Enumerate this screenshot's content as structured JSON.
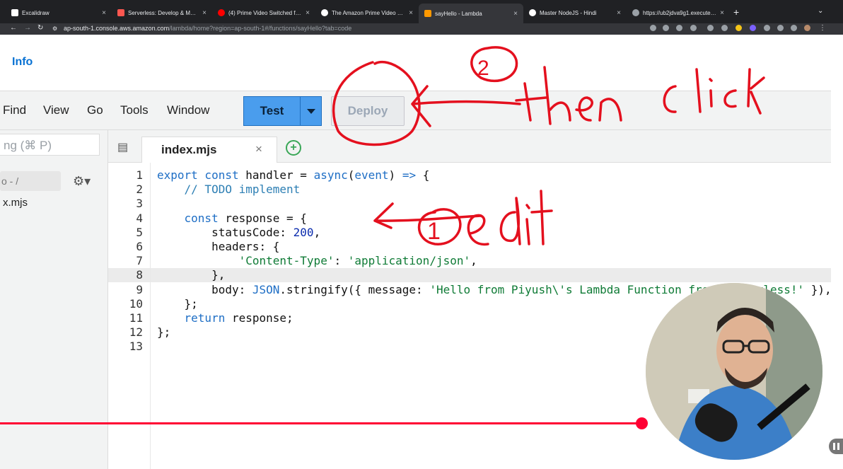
{
  "browser": {
    "tabs": [
      {
        "title": "Excalidraw",
        "favicon_color": "#ffffff",
        "active": false
      },
      {
        "title": "Serverless: Develop & Monitor",
        "favicon_color": "#fd5750",
        "active": false
      },
      {
        "title": "(4) Prime Video Switched from",
        "favicon_color": "#ff0000",
        "active": false
      },
      {
        "title": "The Amazon Prime Video Monit",
        "favicon_color": "#ffffff",
        "active": false
      },
      {
        "title": "sayHello - Lambda",
        "favicon_color": "#ff9900",
        "active": true
      },
      {
        "title": "Master NodeJS - Hindi",
        "favicon_color": "#ffffff",
        "active": false
      },
      {
        "title": "https://ub2jdva9g1.execute-ap",
        "favicon_color": "#9aa0a6",
        "active": false
      }
    ],
    "close_glyph": "×",
    "new_tab": "+",
    "url_host": "ap-south-1.console.aws.amazon.com",
    "url_path": "/lambda/home?region=ap-south-1#/functions/sayHello?tab=code"
  },
  "console": {
    "info_label": "Info",
    "menu": [
      "Find",
      "View",
      "Go",
      "Tools",
      "Window"
    ],
    "test_button": "Test",
    "deploy_button": "Deploy",
    "goto_placeholder": "ng (⌘ P)",
    "path_label": "o - /",
    "file_list_item": "x.mjs"
  },
  "editor": {
    "active_file": "index.mjs",
    "close_glyph": "×",
    "add_glyph": "+",
    "line_numbers": [
      "1",
      "2",
      "3",
      "4",
      "5",
      "6",
      "7",
      "8",
      "9",
      "10",
      "11",
      "12",
      "13"
    ]
  },
  "annotations": {
    "step1": "1",
    "step2": "2",
    "edit_text": "edit",
    "click_text": "then click"
  },
  "video": {
    "progress": 0.76
  },
  "colors": {
    "accent": "#4a9ded",
    "info_link": "#0972d3",
    "annotation": "#e4101e",
    "progress": "#ff0033"
  }
}
